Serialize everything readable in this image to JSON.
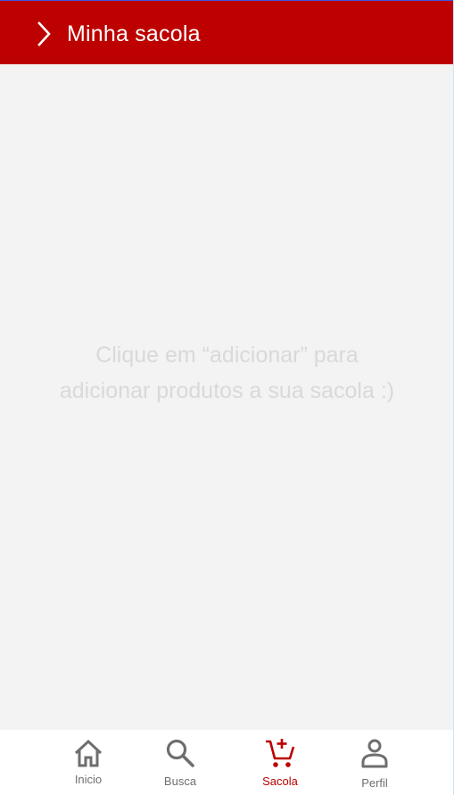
{
  "header": {
    "title": "Minha sacola",
    "back_icon": "chevron-right-icon",
    "background_color": "#bd0000"
  },
  "main": {
    "empty_line_1": "Clique em “adicionar” para",
    "empty_line_2": "adicionar produtos a sua sacola :)"
  },
  "bottom_nav": {
    "items": [
      {
        "label": "Inicio",
        "icon": "home-icon"
      },
      {
        "label": "Busca",
        "icon": "search-icon"
      },
      {
        "label": "Sacola",
        "icon": "cart-add-icon",
        "active": true
      },
      {
        "label": "Perfil",
        "icon": "person-icon"
      }
    ],
    "active_color": "#bd0000",
    "inactive_color": "#6e6e6e"
  }
}
